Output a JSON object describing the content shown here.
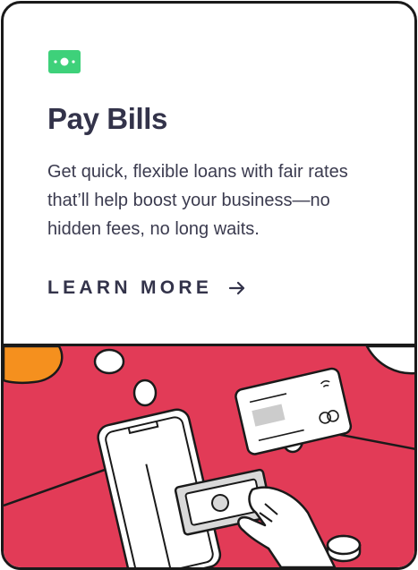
{
  "card": {
    "title": "Pay Bills",
    "description": "Get quick, flexible loans with fair rates that’ll help boost your business—no hidden fees, no long waits.",
    "cta_label": "LEARN MORE",
    "cta_icon": "arrow-right-icon",
    "badge_icon": "cash-icon"
  },
  "colors": {
    "badge": "#3ed17a",
    "title_text": "#33334a",
    "illustration_bg": "#e23b57",
    "accent_orange": "#f5901e",
    "outline": "#1a1a1a"
  }
}
